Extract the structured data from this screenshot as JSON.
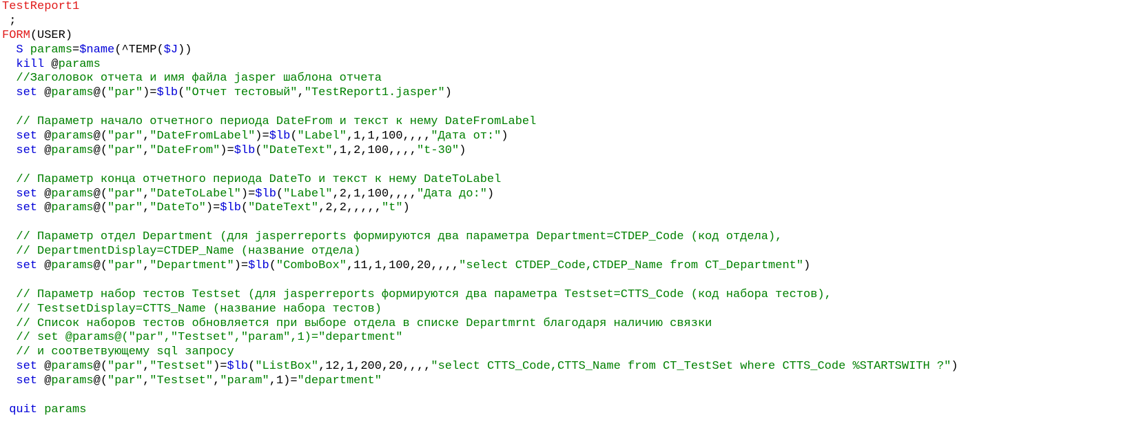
{
  "editor": {
    "lines": [
      [
        {
          "t": "TestReport1",
          "c": "label"
        }
      ],
      [
        {
          "t": " ;",
          "c": "plain"
        }
      ],
      [
        {
          "t": "FORM",
          "c": "label"
        },
        {
          "t": "(USER)",
          "c": "plain"
        }
      ],
      [
        {
          "t": "  ",
          "c": "plain"
        },
        {
          "t": "S",
          "c": "cmd"
        },
        {
          "t": " params",
          "c": "var"
        },
        {
          "t": "=",
          "c": "plain"
        },
        {
          "t": "$name",
          "c": "func"
        },
        {
          "t": "(^TEMP(",
          "c": "plain"
        },
        {
          "t": "$J",
          "c": "func"
        },
        {
          "t": "))",
          "c": "plain"
        }
      ],
      [
        {
          "t": "  ",
          "c": "plain"
        },
        {
          "t": "kill",
          "c": "cmd"
        },
        {
          "t": " @",
          "c": "plain"
        },
        {
          "t": "params",
          "c": "var"
        }
      ],
      [
        {
          "t": "  //Заголовок отчета и имя файла jasper шаблона отчета",
          "c": "comment"
        }
      ],
      [
        {
          "t": "  ",
          "c": "plain"
        },
        {
          "t": "set",
          "c": "cmd"
        },
        {
          "t": " @",
          "c": "plain"
        },
        {
          "t": "params",
          "c": "var"
        },
        {
          "t": "@(",
          "c": "plain"
        },
        {
          "t": "\"par\"",
          "c": "str"
        },
        {
          "t": ")=",
          "c": "plain"
        },
        {
          "t": "$lb",
          "c": "func"
        },
        {
          "t": "(",
          "c": "plain"
        },
        {
          "t": "\"Отчет тестовый\"",
          "c": "str"
        },
        {
          "t": ",",
          "c": "plain"
        },
        {
          "t": "\"TestReport1.jasper\"",
          "c": "str"
        },
        {
          "t": ")",
          "c": "plain"
        }
      ],
      [],
      [
        {
          "t": "  // Параметр начало отчетного периода DateFrom и текст к нему DateFromLabel",
          "c": "comment"
        }
      ],
      [
        {
          "t": "  ",
          "c": "plain"
        },
        {
          "t": "set",
          "c": "cmd"
        },
        {
          "t": " @",
          "c": "plain"
        },
        {
          "t": "params",
          "c": "var"
        },
        {
          "t": "@(",
          "c": "plain"
        },
        {
          "t": "\"par\"",
          "c": "str"
        },
        {
          "t": ",",
          "c": "plain"
        },
        {
          "t": "\"DateFromLabel\"",
          "c": "str"
        },
        {
          "t": ")=",
          "c": "plain"
        },
        {
          "t": "$lb",
          "c": "func"
        },
        {
          "t": "(",
          "c": "plain"
        },
        {
          "t": "\"Label\"",
          "c": "str"
        },
        {
          "t": ",1,1,100,,,,",
          "c": "plain"
        },
        {
          "t": "\"Дата от:\"",
          "c": "str"
        },
        {
          "t": ")",
          "c": "plain"
        }
      ],
      [
        {
          "t": "  ",
          "c": "plain"
        },
        {
          "t": "set",
          "c": "cmd"
        },
        {
          "t": " @",
          "c": "plain"
        },
        {
          "t": "params",
          "c": "var"
        },
        {
          "t": "@(",
          "c": "plain"
        },
        {
          "t": "\"par\"",
          "c": "str"
        },
        {
          "t": ",",
          "c": "plain"
        },
        {
          "t": "\"DateFrom\"",
          "c": "str"
        },
        {
          "t": ")=",
          "c": "plain"
        },
        {
          "t": "$lb",
          "c": "func"
        },
        {
          "t": "(",
          "c": "plain"
        },
        {
          "t": "\"DateText\"",
          "c": "str"
        },
        {
          "t": ",1,2,100,,,,",
          "c": "plain"
        },
        {
          "t": "\"t-30\"",
          "c": "str"
        },
        {
          "t": ")",
          "c": "plain"
        }
      ],
      [],
      [
        {
          "t": "  // Параметр конца отчетного периода DateTo и текст к нему DateToLabel",
          "c": "comment"
        }
      ],
      [
        {
          "t": "  ",
          "c": "plain"
        },
        {
          "t": "set",
          "c": "cmd"
        },
        {
          "t": " @",
          "c": "plain"
        },
        {
          "t": "params",
          "c": "var"
        },
        {
          "t": "@(",
          "c": "plain"
        },
        {
          "t": "\"par\"",
          "c": "str"
        },
        {
          "t": ",",
          "c": "plain"
        },
        {
          "t": "\"DateToLabel\"",
          "c": "str"
        },
        {
          "t": ")=",
          "c": "plain"
        },
        {
          "t": "$lb",
          "c": "func"
        },
        {
          "t": "(",
          "c": "plain"
        },
        {
          "t": "\"Label\"",
          "c": "str"
        },
        {
          "t": ",2,1,100,,,,",
          "c": "plain"
        },
        {
          "t": "\"Дата до:\"",
          "c": "str"
        },
        {
          "t": ")",
          "c": "plain"
        }
      ],
      [
        {
          "t": "  ",
          "c": "plain"
        },
        {
          "t": "set",
          "c": "cmd"
        },
        {
          "t": " @",
          "c": "plain"
        },
        {
          "t": "params",
          "c": "var"
        },
        {
          "t": "@(",
          "c": "plain"
        },
        {
          "t": "\"par\"",
          "c": "str"
        },
        {
          "t": ",",
          "c": "plain"
        },
        {
          "t": "\"DateTo\"",
          "c": "str"
        },
        {
          "t": ")=",
          "c": "plain"
        },
        {
          "t": "$lb",
          "c": "func"
        },
        {
          "t": "(",
          "c": "plain"
        },
        {
          "t": "\"DateText\"",
          "c": "str"
        },
        {
          "t": ",2,2,,,,,",
          "c": "plain"
        },
        {
          "t": "\"t\"",
          "c": "str"
        },
        {
          "t": ")",
          "c": "plain"
        }
      ],
      [],
      [
        {
          "t": "  // Параметр отдел Department (для jasperreports формируются два параметра Department=CTDEP_Code (код отдела),",
          "c": "comment"
        }
      ],
      [
        {
          "t": "  // DepartmentDisplay=CTDEP_Name (название отдела)",
          "c": "comment"
        }
      ],
      [
        {
          "t": "  ",
          "c": "plain"
        },
        {
          "t": "set",
          "c": "cmd"
        },
        {
          "t": " @",
          "c": "plain"
        },
        {
          "t": "params",
          "c": "var"
        },
        {
          "t": "@(",
          "c": "plain"
        },
        {
          "t": "\"par\"",
          "c": "str"
        },
        {
          "t": ",",
          "c": "plain"
        },
        {
          "t": "\"Department\"",
          "c": "str"
        },
        {
          "t": ")=",
          "c": "plain"
        },
        {
          "t": "$lb",
          "c": "func"
        },
        {
          "t": "(",
          "c": "plain"
        },
        {
          "t": "\"ComboBox\"",
          "c": "str"
        },
        {
          "t": ",11,1,100,20,,,,",
          "c": "plain"
        },
        {
          "t": "\"select CTDEP_Code,CTDEP_Name from CT_Department\"",
          "c": "str"
        },
        {
          "t": ")",
          "c": "plain"
        }
      ],
      [],
      [
        {
          "t": "  // Параметр набор тестов Testset (для jasperreports формируются два параметра Testset=CTTS_Code (код набора тестов),",
          "c": "comment"
        }
      ],
      [
        {
          "t": "  // TestsetDisplay=CTTS_Name (название набора тестов)",
          "c": "comment"
        }
      ],
      [
        {
          "t": "  // Список наборов тестов обновляется при выборе отдела в списке Departmrnt благодаря наличию связки",
          "c": "comment"
        }
      ],
      [
        {
          "t": "  // set @params@(\"par\",\"Testset\",\"param\",1)=\"department\"",
          "c": "comment"
        }
      ],
      [
        {
          "t": "  // и соответвующему sql запросу",
          "c": "comment"
        }
      ],
      [
        {
          "t": "  ",
          "c": "plain"
        },
        {
          "t": "set",
          "c": "cmd"
        },
        {
          "t": " @",
          "c": "plain"
        },
        {
          "t": "params",
          "c": "var"
        },
        {
          "t": "@(",
          "c": "plain"
        },
        {
          "t": "\"par\"",
          "c": "str"
        },
        {
          "t": ",",
          "c": "plain"
        },
        {
          "t": "\"Testset\"",
          "c": "str"
        },
        {
          "t": ")=",
          "c": "plain"
        },
        {
          "t": "$lb",
          "c": "func"
        },
        {
          "t": "(",
          "c": "plain"
        },
        {
          "t": "\"ListBox\"",
          "c": "str"
        },
        {
          "t": ",12,1,200,20,,,,",
          "c": "plain"
        },
        {
          "t": "\"select CTTS_Code,CTTS_Name from CT_TestSet where CTTS_Code %STARTSWITH ?\"",
          "c": "str"
        },
        {
          "t": ")",
          "c": "plain"
        }
      ],
      [
        {
          "t": "  ",
          "c": "plain"
        },
        {
          "t": "set",
          "c": "cmd"
        },
        {
          "t": " @",
          "c": "plain"
        },
        {
          "t": "params",
          "c": "var"
        },
        {
          "t": "@(",
          "c": "plain"
        },
        {
          "t": "\"par\"",
          "c": "str"
        },
        {
          "t": ",",
          "c": "plain"
        },
        {
          "t": "\"Testset\"",
          "c": "str"
        },
        {
          "t": ",",
          "c": "plain"
        },
        {
          "t": "\"param\"",
          "c": "str"
        },
        {
          "t": ",1)=",
          "c": "plain"
        },
        {
          "t": "\"department\"",
          "c": "str"
        }
      ],
      [],
      [
        {
          "t": " ",
          "c": "plain"
        },
        {
          "t": "quit",
          "c": "cmd"
        },
        {
          "t": " params",
          "c": "var"
        }
      ]
    ]
  },
  "colors": {
    "label": "#e11a1a",
    "command": "#0000d8",
    "comment": "#008000",
    "string": "#008000",
    "plain": "#000000"
  }
}
